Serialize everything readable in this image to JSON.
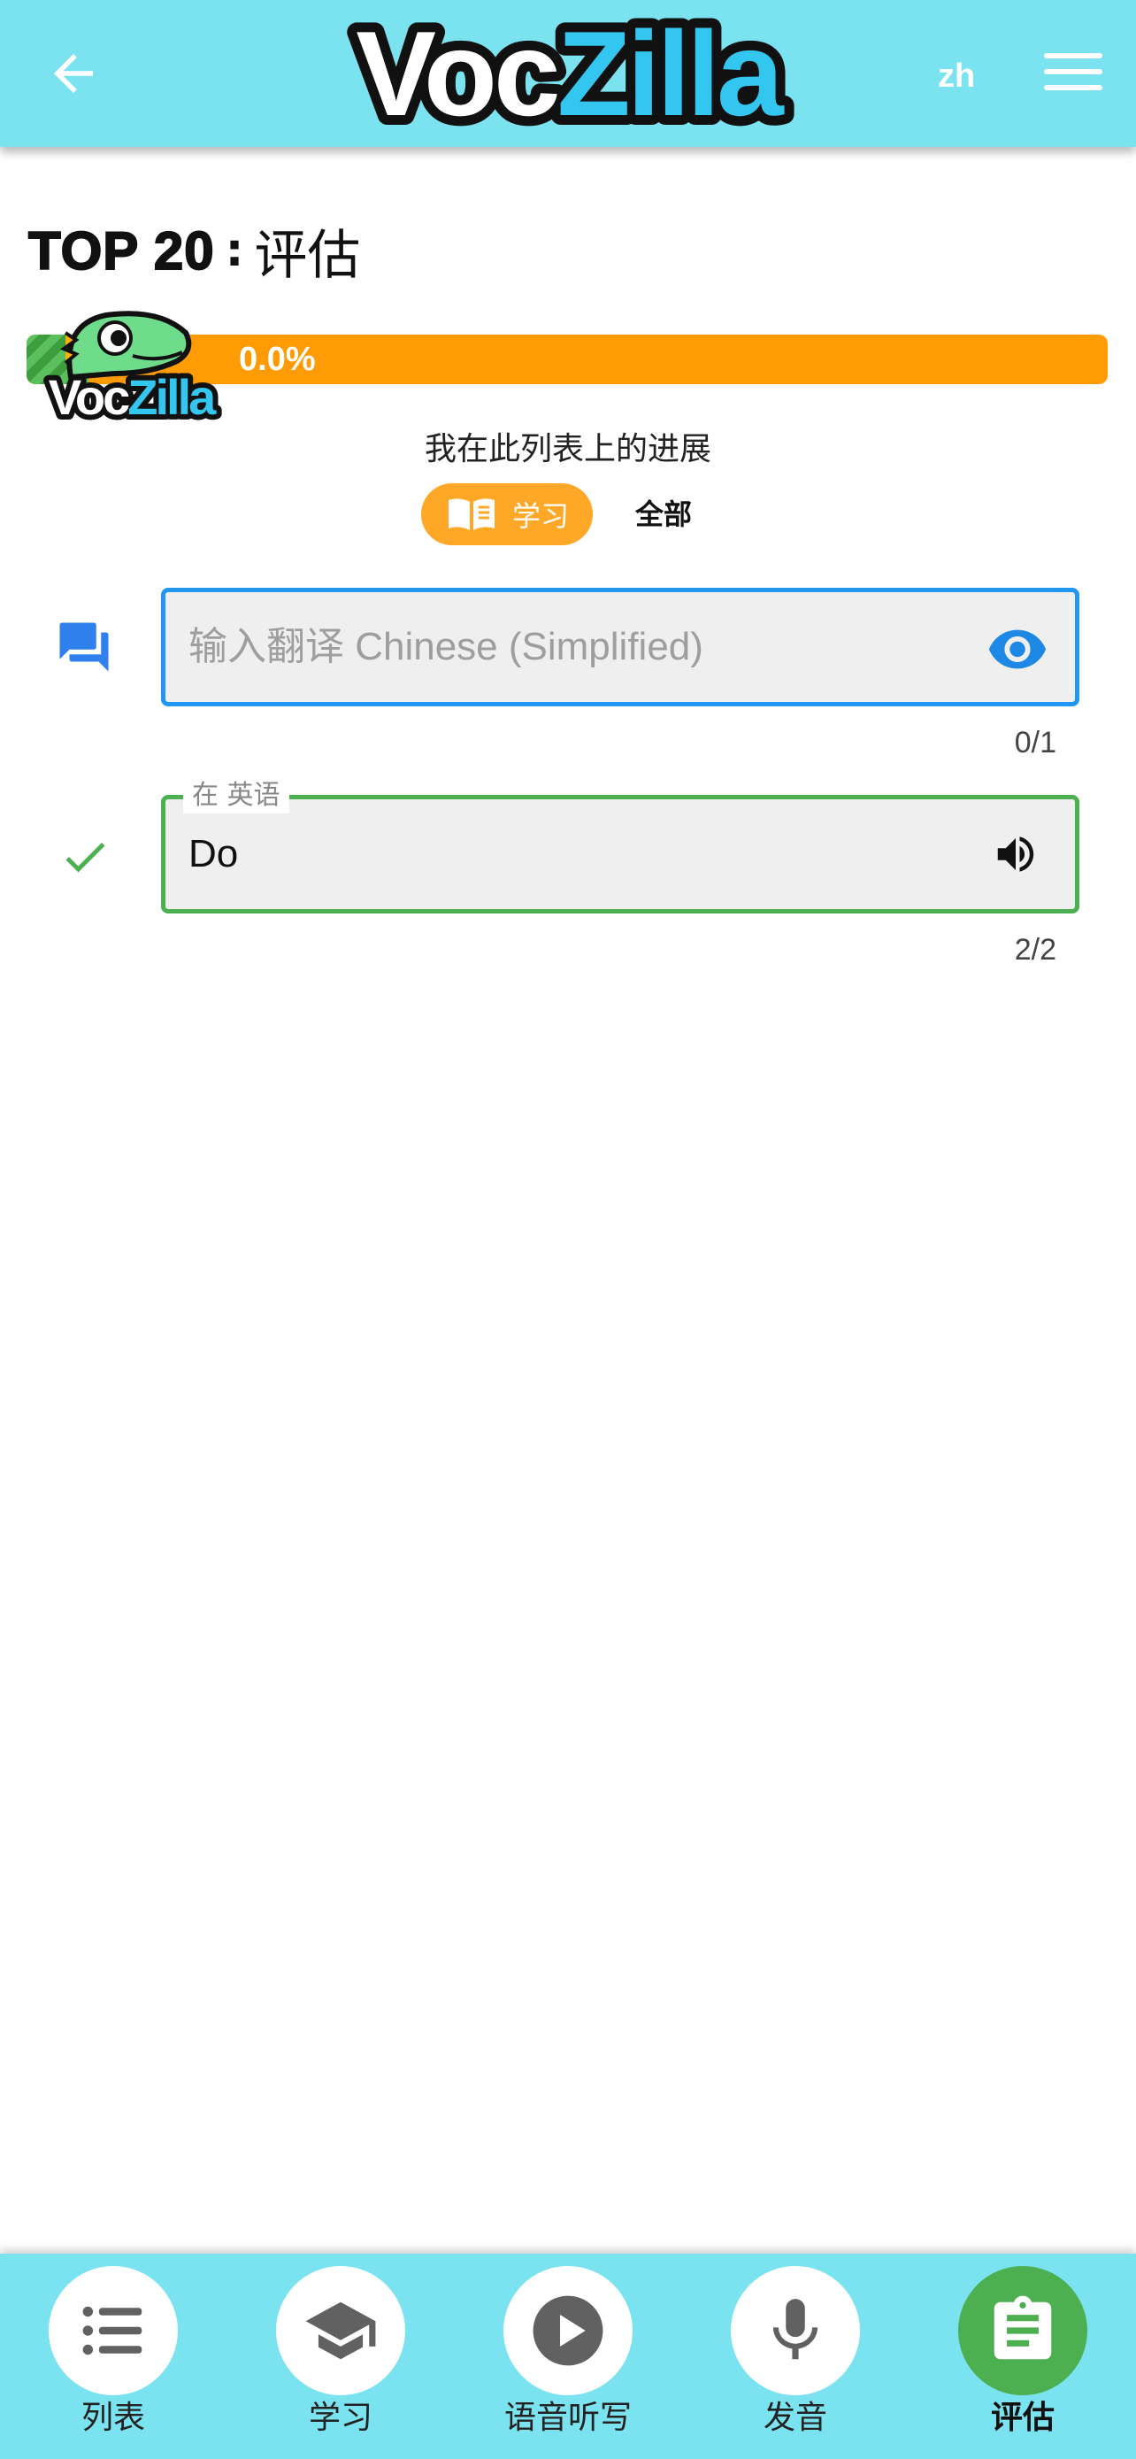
{
  "app": {
    "name": "VocZilla",
    "language_code": "zh"
  },
  "page": {
    "title_list": "TOP 20",
    "title_sep": " : ",
    "title_mode": "评估"
  },
  "progress": {
    "percent_text": "0.0%",
    "value": 0.0,
    "label": "我在此列表上的进展",
    "toggle_learn": "学习",
    "toggle_all": "全部"
  },
  "fields": {
    "translation": {
      "placeholder": "输入翻译 Chinese (Simplified)",
      "value": "",
      "counter": "0/1"
    },
    "english": {
      "legend": "在 英语",
      "value": "Do",
      "counter": "2/2"
    }
  },
  "colors": {
    "header": "#7be3ef",
    "progress": "#ff9b05",
    "active_nav": "#4caf50",
    "focus_blue": "#2196f3",
    "correct_green": "#4caf50"
  },
  "nav": [
    {
      "label": "列表",
      "icon": "list-icon"
    },
    {
      "label": "学习",
      "icon": "graduation-cap-icon"
    },
    {
      "label": "语音听写",
      "icon": "play-icon"
    },
    {
      "label": "发音",
      "icon": "microphone-icon"
    },
    {
      "label": "评估",
      "icon": "clipboard-icon",
      "active": true
    }
  ]
}
